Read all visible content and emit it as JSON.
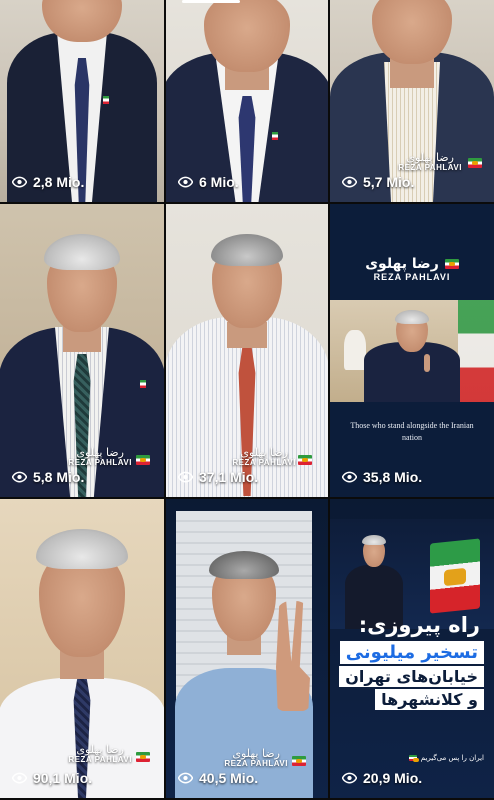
{
  "tiles": [
    {
      "views": "2,8 Mio."
    },
    {
      "views": "6 Mio."
    },
    {
      "views": "5,7 Mio.",
      "watermark_fa": "رضا پهلوی",
      "watermark_en": "REZA PAHLAVI"
    },
    {
      "views": "5,8 Mio.",
      "watermark_fa": "رضا پهلوی",
      "watermark_en": "REZA PAHLAVI"
    },
    {
      "views": "37,1 Mio.",
      "watermark_fa": "رضا پهلوی",
      "watermark_en": "REZA PAHLAVI"
    },
    {
      "views": "35,8 Mio.",
      "logo_fa": "رضا پهلوی",
      "logo_en": "REZA PAHLAVI",
      "caption": "Those who stand alongside the Iranian nation"
    },
    {
      "views": "90,1 Mio.",
      "watermark_fa": "رضا پهلوی",
      "watermark_en": "REZA PAHLAVI"
    },
    {
      "views": "40,5 Mio.",
      "watermark_fa": "رضا پهلوی",
      "watermark_en": "REZA PAHLAVI"
    },
    {
      "views": "20,9 Mio.",
      "headline": [
        "راه پیروزی:",
        "تسخیر میلیونی",
        "خیابان‌های تهران",
        "و کلانشهرها"
      ],
      "footer": "ایران را پس می‌گیریم"
    }
  ],
  "icons": {
    "views": "eye-icon"
  },
  "colors": {
    "background": "#000000",
    "navy": "#0c1d3a",
    "accent_blue": "#1d6ce3"
  }
}
